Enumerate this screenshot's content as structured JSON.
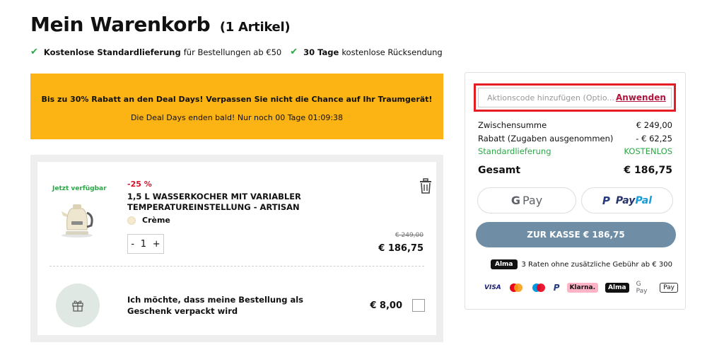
{
  "header": {
    "title": "Mein Warenkorb",
    "item_count": "(1 Artikel)"
  },
  "benefits": [
    {
      "bold": "Kostenlose Standardlieferung",
      "rest": "für Bestellungen ab €50"
    },
    {
      "bold": "30 Tage",
      "rest": "kostenlose Rücksendung"
    }
  ],
  "promo": {
    "headline": "Bis zu 30% Rabatt an den Deal Days! Verpassen Sie nicht die Chance auf Ihr Traumgerät!",
    "countdown": "Die Deal Days enden bald! Nur noch 00 Tage 01:09:38",
    "color": "#fcb415"
  },
  "cart": {
    "item": {
      "availability": "Jetzt verfügbar",
      "discount": "-25 %",
      "name": "1,5 L WASSERKOCHER MIT VARIABLER TEMPERATUREINSTELLUNG - ARTISAN",
      "variant": "Crème",
      "quantity": "1",
      "minus": "-",
      "plus": "+",
      "old_price": "€ 249,00",
      "price": "€ 186,75"
    },
    "gift": {
      "label": "Ich möchte, dass meine Bestellung als Geschenk verpackt wird",
      "price": "€ 8,00"
    }
  },
  "summary": {
    "code_placeholder": "Aktionscode hinzufügen (Optio...",
    "apply_label": "Anwenden",
    "rows": {
      "subtotal_label": "Zwischensumme",
      "subtotal_value": "€ 249,00",
      "discount_label": "Rabatt (Zugaben ausgenommen)",
      "discount_value": "- € 62,25",
      "shipping_label": "Standardlieferung",
      "shipping_value": "KOSTENLOS",
      "total_label": "Gesamt",
      "total_value": "€ 186,75"
    },
    "gpay_label": "Pay",
    "gpay_g": "G",
    "paypal_pay": "Pay",
    "paypal_pal": "Pal",
    "checkout_label": "ZUR KASSE € 186,75",
    "alma_badge": "Alma",
    "alma_text": "3 Raten ohne zusätzliche Gebühr ab € 300",
    "methods": {
      "visa": "VISA",
      "klarna": "Klarna.",
      "alma": "Alma",
      "gpay": "G Pay",
      "applepay": "Pay"
    },
    "checkout_color": "#6f8ea6",
    "accent_red": "#b0143d",
    "green": "#2aa846"
  }
}
